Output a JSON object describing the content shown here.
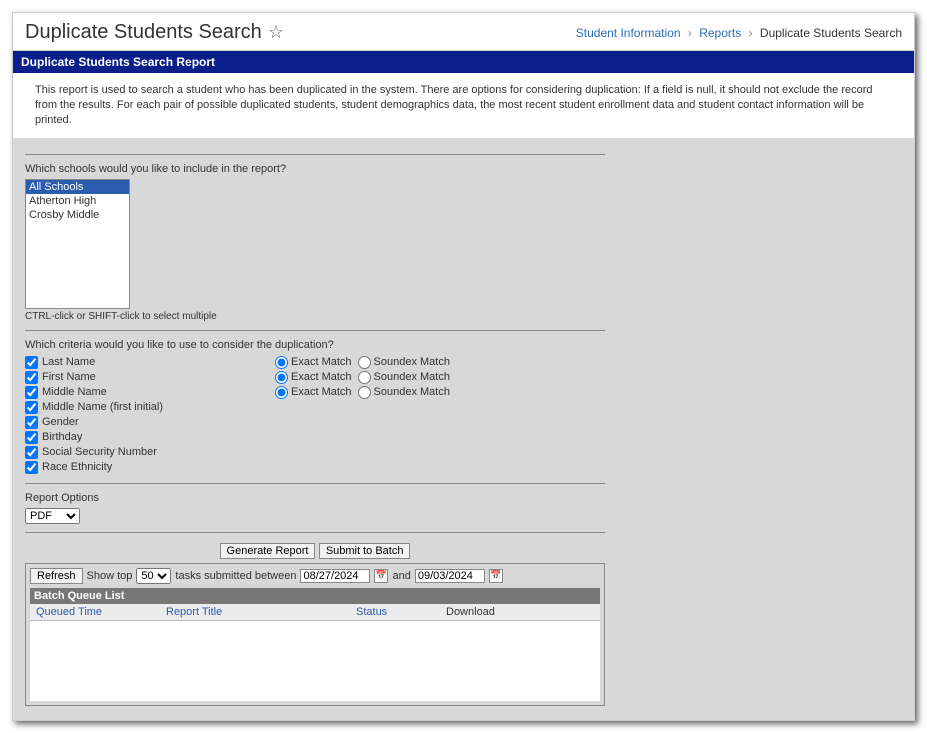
{
  "header": {
    "title": "Duplicate Students Search",
    "breadcrumb": {
      "a": "Student Information",
      "b": "Reports",
      "c": "Duplicate Students Search"
    }
  },
  "banner": "Duplicate Students Search Report",
  "intro": "This report is used to search a student who has been duplicated in the system. There are options for considering duplication: If a field is null, it should not exclude the record from the results. For each pair of possible duplicated students, student demographics data, the most recent student enrollment data and student contact information will be printed.",
  "schools": {
    "question": "Which schools would you like to include in the report?",
    "options": [
      "All Schools",
      "Atherton High",
      "Crosby Middle"
    ],
    "selected_index": 0,
    "hint": "CTRL-click or SHIFT-click to select multiple"
  },
  "criteria": {
    "question": "Which criteria would you like to use to consider the duplication?",
    "match_labels": {
      "exact": "Exact Match",
      "soundex": "Soundex Match"
    },
    "items": [
      {
        "label": "Last Name",
        "checked": true,
        "has_match": true,
        "match": "exact"
      },
      {
        "label": "First Name",
        "checked": true,
        "has_match": true,
        "match": "exact"
      },
      {
        "label": "Middle Name",
        "checked": true,
        "has_match": true,
        "match": "exact"
      },
      {
        "label": "Middle Name (first initial)",
        "checked": true,
        "has_match": false
      },
      {
        "label": "Gender",
        "checked": true,
        "has_match": false
      },
      {
        "label": "Birthday",
        "checked": true,
        "has_match": false
      },
      {
        "label": "Social Security Number",
        "checked": true,
        "has_match": false
      },
      {
        "label": "Race Ethnicity",
        "checked": true,
        "has_match": false
      }
    ]
  },
  "report_options": {
    "label": "Report Options",
    "format_value": "PDF"
  },
  "buttons": {
    "generate": "Generate Report",
    "submit": "Submit to Batch",
    "refresh": "Refresh"
  },
  "batch": {
    "show_top_prefix": "Show top",
    "show_top_value": "50",
    "tasks_between": "tasks submitted between",
    "date_from": "08/27/2024",
    "and": "and",
    "date_to": "09/03/2024",
    "queue_title": "Batch Queue List",
    "cols": {
      "queued": "Queued Time",
      "title": "Report Title",
      "status": "Status",
      "download": "Download"
    }
  }
}
